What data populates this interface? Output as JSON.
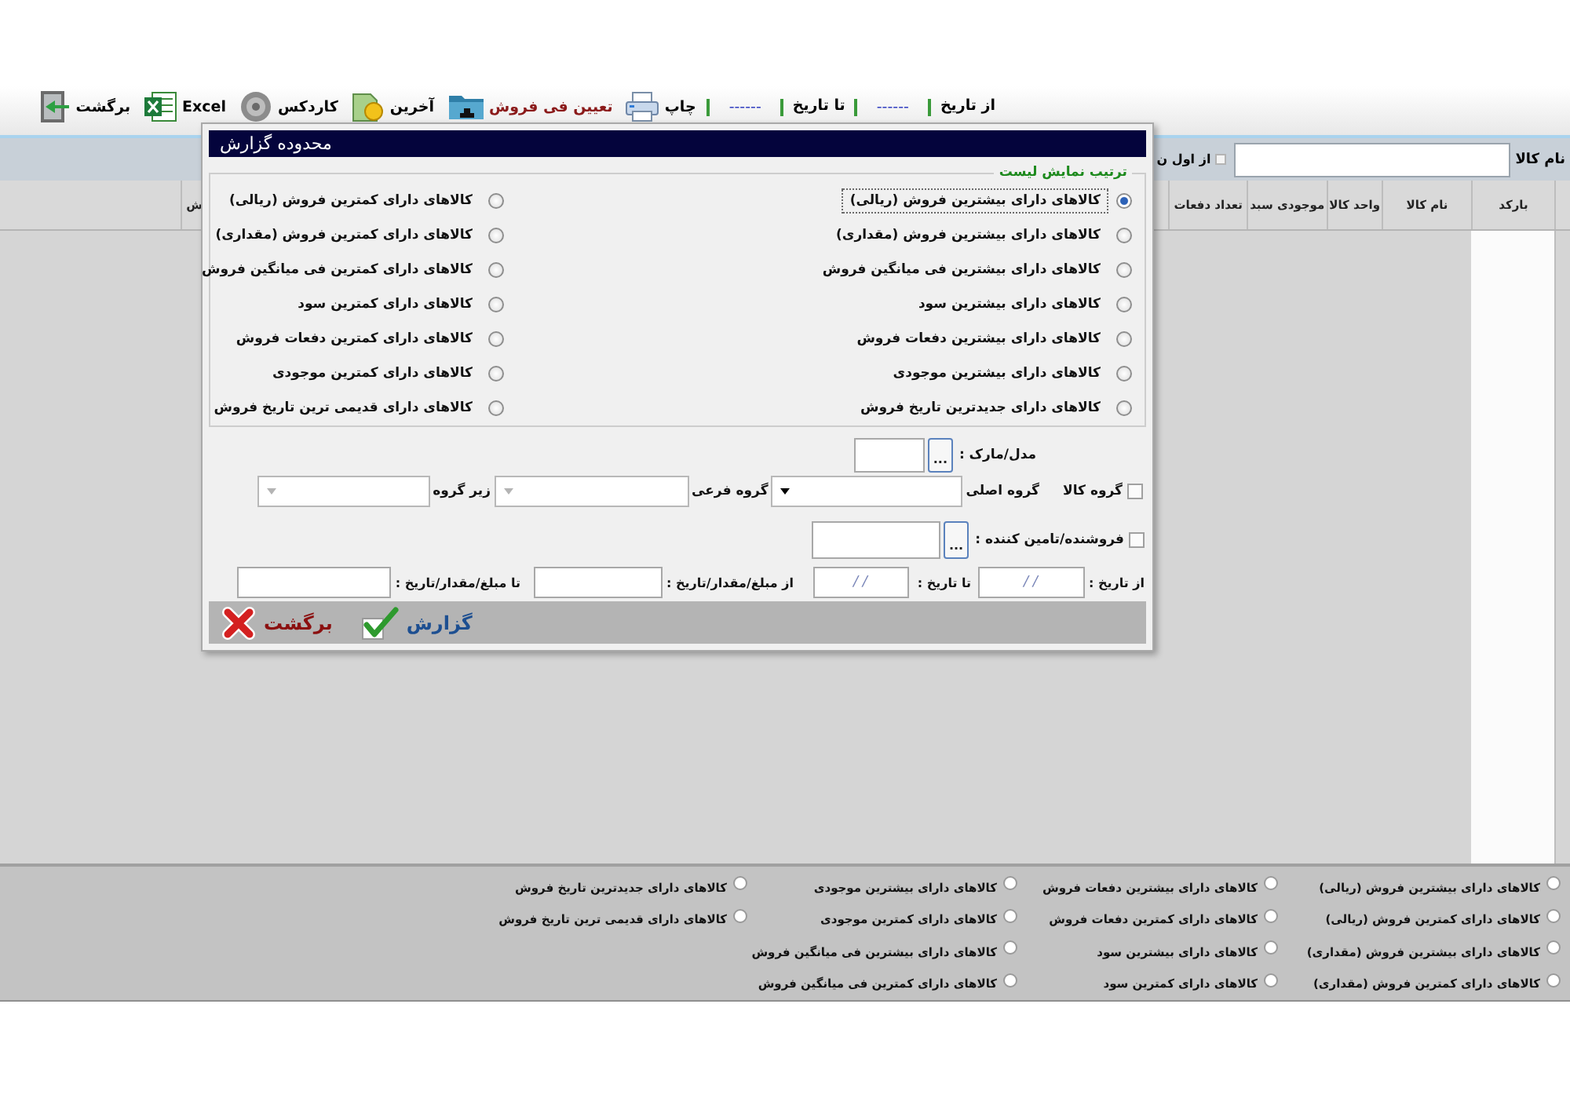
{
  "toolbar": {
    "items": [
      {
        "kind": "label",
        "text": "از تاریخ"
      },
      {
        "kind": "date",
        "text": "------"
      },
      {
        "kind": "label",
        "text": "تا تاریخ"
      },
      {
        "kind": "date",
        "text": "------"
      },
      {
        "kind": "print",
        "text": "چاپ",
        "color": "#000000"
      },
      {
        "kind": "price",
        "text": "تعیین فی فروش",
        "color": "#8b1a1a"
      },
      {
        "kind": "latest",
        "text": "آخرین",
        "color": "#000000"
      },
      {
        "kind": "cardex",
        "text": "کاردکس",
        "color": "#000000"
      },
      {
        "kind": "excel",
        "text": "Excel",
        "color": "#000000"
      },
      {
        "kind": "back",
        "text": "برگشت",
        "color": "#000000"
      }
    ]
  },
  "filter_bar": {
    "label": "نام کالا",
    "option": {
      "label": "از اول ن",
      "checked": false
    }
  },
  "table": {
    "columns": [
      "بارکد",
      "نام کالا",
      "واحد کالا",
      "موجودی سبد",
      "تعداد دفعات",
      "ش"
    ]
  },
  "dialog": {
    "title": "محدوده گزارش",
    "order_group": {
      "legend": "ترتیب نمایش لیست",
      "options": [
        {
          "label": "کالاهای دارای بیشترین فروش (ریالی)",
          "selected": true
        },
        {
          "label": "کالاهای دارای کمترین فروش (ریالی)",
          "selected": false
        },
        {
          "label": "کالاهای دارای بیشترین فروش (مقداری)",
          "selected": false
        },
        {
          "label": "کالاهای دارای کمترین فروش (مقداری)",
          "selected": false
        },
        {
          "label": "کالاهای دارای بیشترین فی میانگین فروش",
          "selected": false
        },
        {
          "label": "کالاهای دارای کمترین فی میانگین فروش",
          "selected": false
        },
        {
          "label": "کالاهای دارای بیشترین سود",
          "selected": false
        },
        {
          "label": "کالاهای دارای کمترین سود",
          "selected": false
        },
        {
          "label": "کالاهای دارای بیشترین دفعات فروش",
          "selected": false
        },
        {
          "label": "کالاهای دارای کمترین دفعات فروش",
          "selected": false
        },
        {
          "label": "کالاهای دارای بیشترین موجودی",
          "selected": false
        },
        {
          "label": "کالاهای دارای کمترین موجودی",
          "selected": false
        },
        {
          "label": "کالاهای دارای جدیدترین تاریخ فروش",
          "selected": false
        },
        {
          "label": "کالاهای دارای قدیمی ترین تاریخ فروش",
          "selected": false
        }
      ]
    },
    "model": {
      "label": "مدل/مارک :",
      "button": "..."
    },
    "goods_group": {
      "label": "گروه کالا",
      "checked": false,
      "fields": [
        {
          "label": "گروه اصلی",
          "disabled": false
        },
        {
          "label": "گروه فرعی",
          "disabled": true
        },
        {
          "label": "زیر گروه",
          "disabled": true
        }
      ]
    },
    "supplier": {
      "label": "فروشنده/تامین کننده :",
      "checked": false,
      "button": "..."
    },
    "ranges": [
      {
        "label": "از تاریخ :",
        "value": "/ /"
      },
      {
        "label": "تا تاریخ :",
        "value": "/ /"
      },
      {
        "label": "از مبلغ/مقدار/تاریخ :"
      },
      {
        "label": "تا مبلغ/مقدار/تاریخ :"
      }
    ],
    "buttons": [
      {
        "kind": "report",
        "text": "گزارش"
      },
      {
        "kind": "back",
        "text": "برگشت"
      }
    ]
  },
  "bottom_panel": {
    "columns": [
      [
        {
          "label": "کالاهای دارای بیشترین فروش (ریالی)",
          "selected": false
        },
        {
          "label": "کالاهای دارای کمترین فروش (ریالی)",
          "selected": false
        },
        {
          "label": "کالاهای دارای بیشترین فروش (مقداری)",
          "selected": false
        },
        {
          "label": "کالاهای دارای کمترین فروش (مقداری)",
          "selected": false
        }
      ],
      [
        {
          "label": "کالاهای دارای بیشترین دفعات فروش",
          "selected": false
        },
        {
          "label": "کالاهای دارای کمترین دفعات فروش",
          "selected": false
        },
        {
          "label": "کالاهای دارای بیشترین سود",
          "selected": false
        },
        {
          "label": "کالاهای دارای کمترین سود",
          "selected": false
        }
      ],
      [
        {
          "label": "کالاهای دارای بیشترین موجودی",
          "selected": false
        },
        {
          "label": "کالاهای دارای کمترین موجودی",
          "selected": false
        },
        {
          "label": "کالاهای دارای بیشترین فی میانگین فروش",
          "selected": false
        },
        {
          "label": "کالاهای دارای کمترین فی میانگین فروش",
          "selected": false
        }
      ],
      [
        {
          "label": "کالاهای دارای جدیدترین تاریخ فروش",
          "selected": false
        },
        {
          "label": "کالاهای دارای قدیمی ترین تاریخ فروش",
          "selected": false
        }
      ]
    ]
  }
}
